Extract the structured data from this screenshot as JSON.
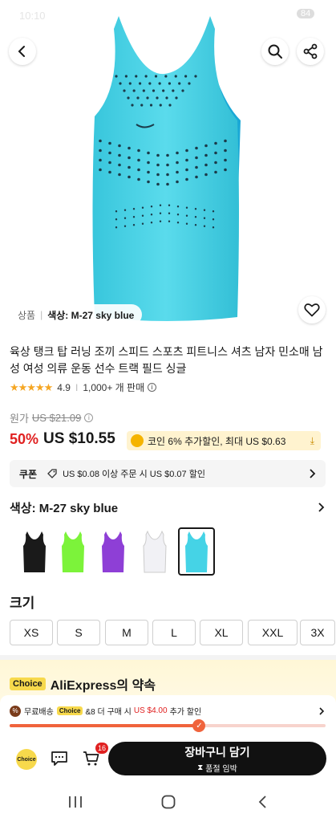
{
  "status_bar": {
    "time": "10:10",
    "battery": "84"
  },
  "header": {
    "back_icon": "chevron-left-icon",
    "search_icon": "search-icon",
    "share_icon": "share-icon"
  },
  "hero": {
    "tag_prefix": "상품",
    "tag_variant": "색상: M-27 sky blue",
    "wishlist_icon": "heart-icon"
  },
  "product": {
    "title": "육상 탱크 탑 러닝 조끼 스피드 스포츠 피트니스 셔츠 남자 민소매 남성 여성 의류 운동 선수 트랙 필드 싱글",
    "rating": "4.9",
    "sold": "1,000+ 개 판매",
    "original_label": "원가",
    "original_price": "US $21.09",
    "discount": "50%",
    "price": "US $10.55",
    "coin_text": "코인 6% 추가할인, 최대 US $0.63"
  },
  "coupon": {
    "label": "쿠폰",
    "text": "US $0.08 이상 주문 시 US $0.07 할인"
  },
  "color": {
    "title": "색상: M-27 sky blue",
    "options": [
      {
        "name": "black",
        "hex": "#1a1a1a"
      },
      {
        "name": "lime",
        "hex": "#7cf33a"
      },
      {
        "name": "purple",
        "hex": "#8e3fd6"
      },
      {
        "name": "white",
        "hex": "#f1f1f5"
      },
      {
        "name": "sky blue",
        "hex": "#45d3e6"
      }
    ],
    "selected_index": 4
  },
  "size": {
    "title": "크기",
    "options": [
      "XS",
      "S",
      "M",
      "L",
      "XL",
      "XXL",
      "3X"
    ]
  },
  "promise": {
    "badge": "Choice",
    "title": "AliExpress의 약속",
    "shipping_prefix": "무료배송",
    "shipping_badge": "Choice",
    "shipping_text_1": "&8 더 구매 시",
    "shipping_amount": "US $4.00",
    "shipping_text_2": "추가 할인",
    "progress": 0.6
  },
  "bottom": {
    "choice_label": "Choice",
    "cart_count": "16",
    "cart_button": "장바구니 담기",
    "cart_sub": "품절 임박"
  },
  "colors": {
    "accent_red": "#e02020",
    "brand_yellow": "#f7d94c",
    "product": "#45d3e6"
  }
}
